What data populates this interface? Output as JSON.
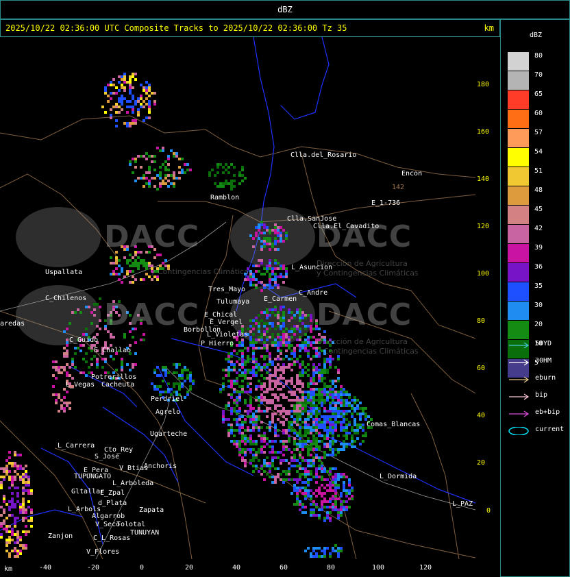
{
  "window": {
    "title": "dBZ"
  },
  "header": {
    "text": "2025/10/22 02:36:00 UTC Composite Tracks to 2025/10/22 02:36:00 Tz 35",
    "unit": "km"
  },
  "axes": {
    "y_labels": [
      "180",
      "160",
      "140",
      "120",
      "100",
      "80",
      "60",
      "40",
      "20",
      "0"
    ],
    "x_labels": [
      "-40",
      "-20",
      "0",
      "20",
      "40",
      "60",
      "80",
      "100",
      "120"
    ],
    "x_unit": "km"
  },
  "legend": {
    "title": "dBZ",
    "scale": [
      {
        "label": "80",
        "color": "#d2d2d2"
      },
      {
        "label": "70",
        "color": "#b4b4b4"
      },
      {
        "label": "65",
        "color": "#ff3c28"
      },
      {
        "label": "60",
        "color": "#ff6e14"
      },
      {
        "label": "57",
        "color": "#ff9b5a"
      },
      {
        "label": "54",
        "color": "#ffff00"
      },
      {
        "label": "51",
        "color": "#f0c832"
      },
      {
        "label": "48",
        "color": "#dc9b3c"
      },
      {
        "label": "45",
        "color": "#d28282"
      },
      {
        "label": "42",
        "color": "#c864a0"
      },
      {
        "label": "39",
        "color": "#c814a0"
      },
      {
        "label": "36",
        "color": "#7814c8"
      },
      {
        "label": "35",
        "color": "#1e50ff"
      },
      {
        "label": "30",
        "color": "#1e8cf0"
      },
      {
        "label": "20",
        "color": "#148c14"
      },
      {
        "label": "10",
        "color": "#0a6e0a"
      },
      {
        "label": "5",
        "color": "#463c8c"
      }
    ],
    "tracks": [
      {
        "label": "50YD",
        "color": "#46c8dc",
        "icon": "arrow-icon"
      },
      {
        "label": "30HM",
        "color": "#ffffff",
        "icon": "arrow-icon"
      },
      {
        "label": "eburn",
        "color": "#e6c88c",
        "icon": "arrow-icon"
      },
      {
        "label": "bip",
        "color": "#ffc8dc",
        "icon": "arrow-icon"
      },
      {
        "label": "eb+bip",
        "color": "#dc50dc",
        "icon": "arrow-icon"
      },
      {
        "label": "current",
        "color": "#00e6ff",
        "icon": "ellipse-icon"
      }
    ]
  },
  "watermark": {
    "brand": "DACC",
    "line1": "Dirección de Agricultura",
    "line2": "y Contingencias Climáticas"
  },
  "places": [
    "Clla.del_Rosario",
    "Encon",
    "142",
    "E_1-736",
    "Ramblon",
    "Clla.SanJose",
    "Clla.El_Cavadito",
    "Uspallata",
    "C_Chilenos",
    "Tres_Mayo",
    "Tulumaya",
    "L_Asuncion",
    "E_Carmen",
    "C_Andre",
    "E_Chical",
    "E_Vergel",
    "Borbollon",
    "L_Violetas",
    "P_Hierro",
    "C_Guido",
    "E_Challao",
    "Potrerillos",
    "L_Vegas",
    "Cacheuta",
    "Perdriel",
    "Agrelo",
    "Ugarteche",
    "L_Carrera",
    "Cto_Rey",
    "S_Jose",
    "E_Pera",
    "TUPUNGATO",
    "V_Btias",
    "Anchoris",
    "L_Arboleda",
    "Gltallar",
    "E_Zpal",
    "L_Arbols",
    "d_Plata",
    "Algarrob",
    "Zapata",
    "V_Seco",
    "TUNUYAN",
    "C_L_Rosas",
    "V_Flores",
    "Comas_Blancas",
    "L_Dormida",
    "L_PAZ",
    "aredas",
    "Tolotal",
    "Zanjon"
  ]
}
